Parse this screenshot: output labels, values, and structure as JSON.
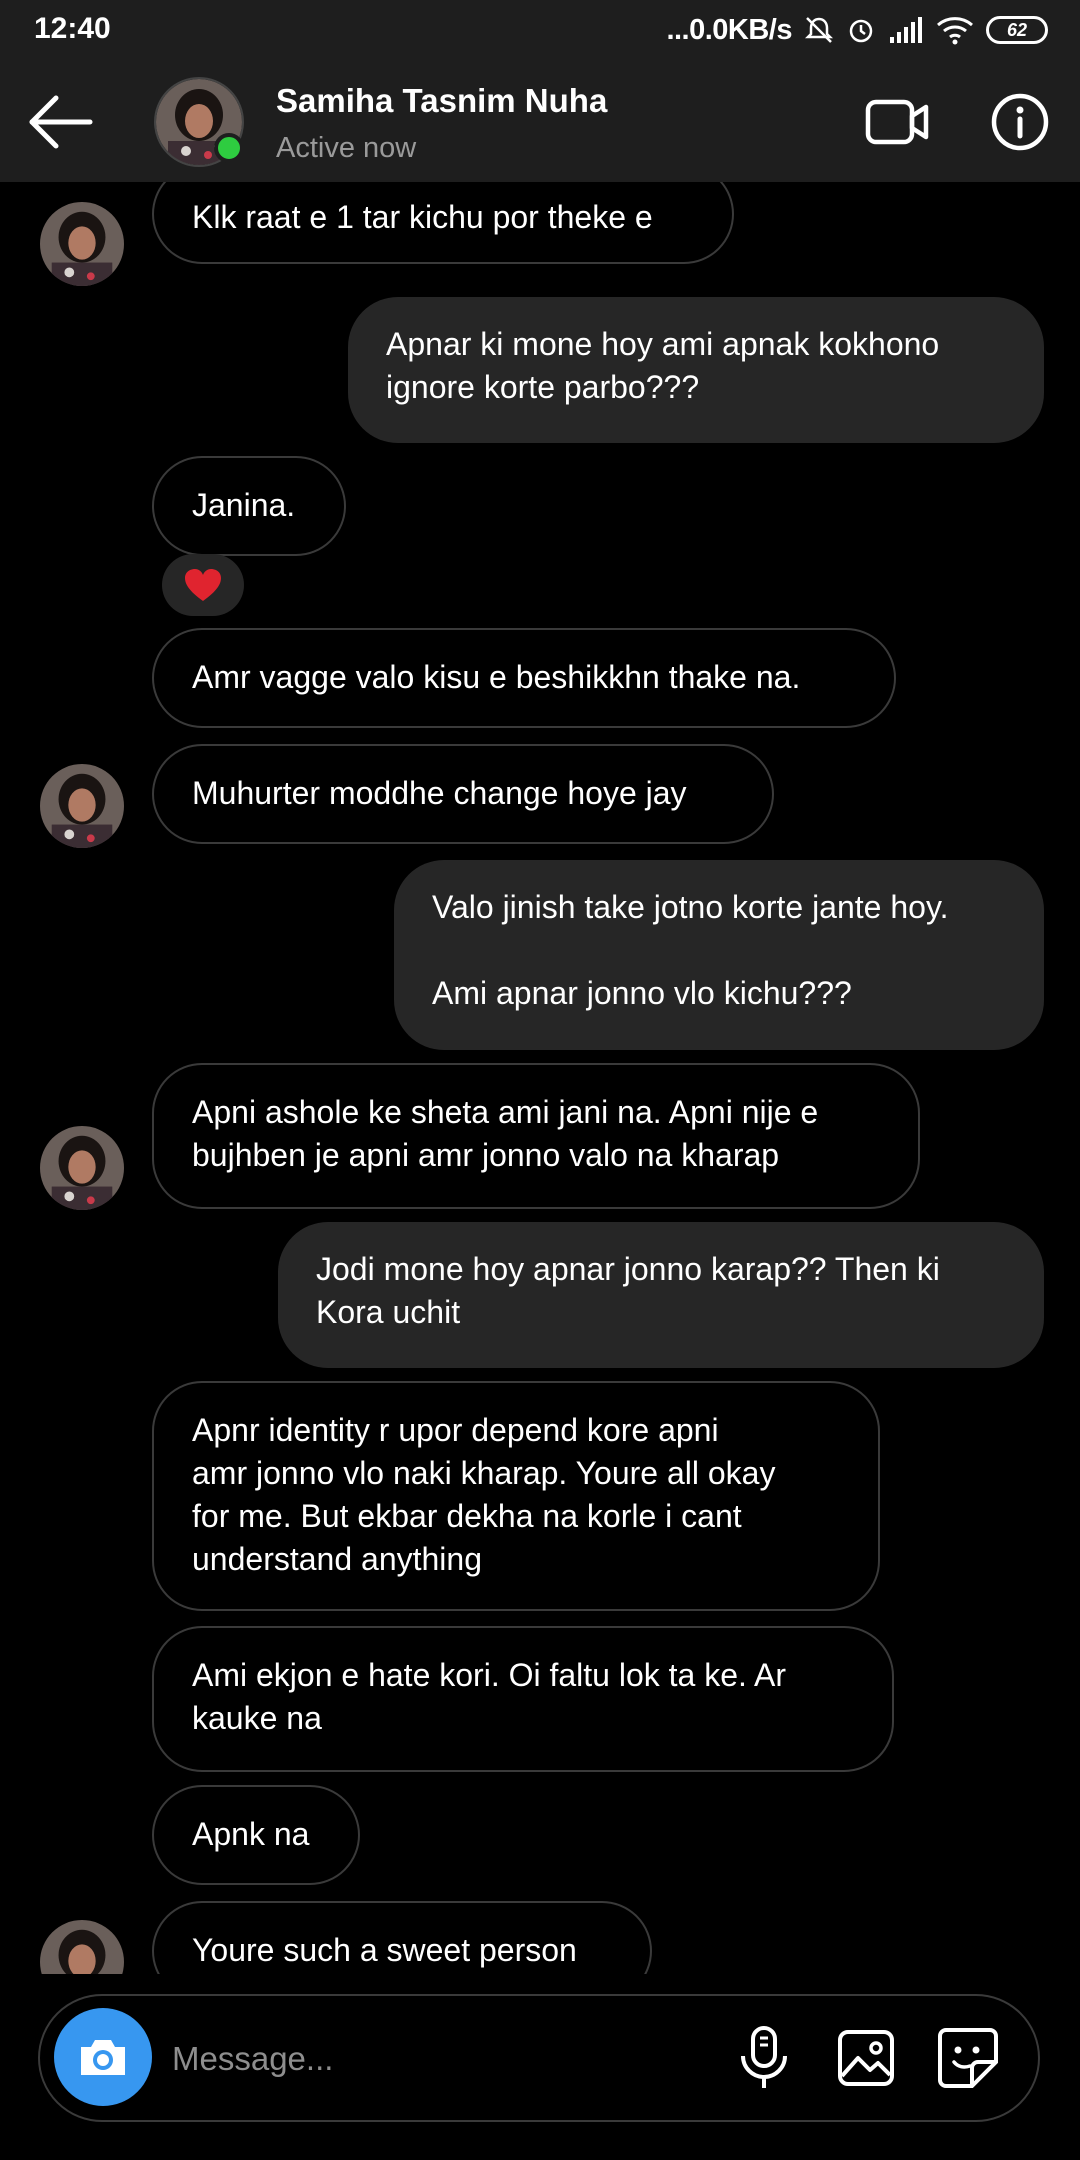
{
  "status_bar": {
    "time": "12:40",
    "speed": "...0.0KB/s",
    "battery": "62"
  },
  "header": {
    "name": "Samiha Tasnim Nuha",
    "status": "Active now"
  },
  "messages": {
    "m1": "Klk raat e 1 tar kichu por theke e",
    "m2": "Apnar ki mone hoy ami apnak kokhono\nignore korte parbo???",
    "m3": "Janina.",
    "m3_reaction": "❤️",
    "m4": "Amr vagge valo kisu e beshikkhn thake na.",
    "m5": "Muhurter moddhe change hoye jay",
    "m6": "Valo jinish take jotno korte jante hoy.\n\nAmi apnar jonno vlo kichu???",
    "m7": "Apni ashole ke sheta ami jani na. Apni nije e\nbujhben je apni amr jonno valo na kharap",
    "m8": "Jodi mone hoy apnar jonno karap?? Then ki\nKora uchit",
    "m9": "Apnr identity r upor depend kore apni\namr jonno vlo naki kharap. Youre all okay\nfor me. But ekbar dekha na korle i cant\nunderstand anything",
    "m10": "Ami ekjon e hate kori. Oi faltu lok ta ke. Ar\nkauke na",
    "m11": "Apnk na",
    "m12": "Youre such a sweet person"
  },
  "composer": {
    "placeholder": "Message..."
  },
  "icons": {
    "back": "arrow-left-icon",
    "video": "video-camera-icon",
    "info": "info-icon",
    "camera": "camera-icon",
    "mic": "microphone-icon",
    "gallery": "image-icon",
    "sticker": "sticker-icon"
  },
  "colors": {
    "background": "#000000",
    "header": "#1e1e1e",
    "outgoing_bubble": "#262626",
    "incoming_border": "#3a3a3a",
    "camera_button": "#3797f0",
    "online": "#2ecc40"
  }
}
